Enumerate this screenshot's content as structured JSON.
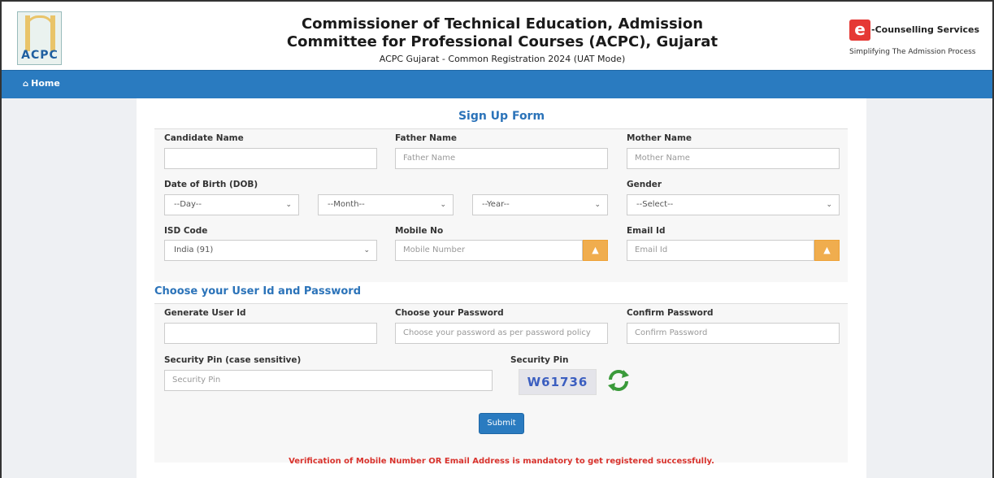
{
  "header": {
    "logo_text": "ACPC",
    "title_line1": "Commissioner of Technical Education, Admission",
    "title_line2": "Committee for Professional Courses (ACPC), Gujarat",
    "subtitle": "ACPC Gujarat - Common Registration 2024 (UAT Mode)",
    "ecoun_brand": "-Counselling Services",
    "ecoun_tagline": "Simplifying The Admission Process",
    "ecoun_mark": "e"
  },
  "nav": {
    "home_label": "Home"
  },
  "form": {
    "title": "Sign Up Form",
    "candidate_name": {
      "label": "Candidate Name",
      "value": "",
      "placeholder": ""
    },
    "father_name": {
      "label": "Father Name",
      "value": "",
      "placeholder": "Father Name"
    },
    "mother_name": {
      "label": "Mother Name",
      "value": "",
      "placeholder": "Mother Name"
    },
    "dob": {
      "label": "Date of Birth (DOB)",
      "day": "--Day--",
      "month": "--Month--",
      "year": "--Year--"
    },
    "gender": {
      "label": "Gender",
      "value": "--Select--"
    },
    "isd": {
      "label": "ISD Code",
      "value": "India (91)"
    },
    "mobile": {
      "label": "Mobile No",
      "placeholder": "Mobile Number"
    },
    "email": {
      "label": "Email Id",
      "placeholder": "Email Id"
    },
    "section2_title": "Choose your User Id and Password",
    "user_id": {
      "label": "Generate User Id",
      "value": ""
    },
    "password": {
      "label": "Choose your Password",
      "placeholder": "Choose your password as per password policy"
    },
    "confirm_password": {
      "label": "Confirm Password",
      "placeholder": "Confirm Password"
    },
    "security_pin_input": {
      "label": "Security Pin (case sensitive)",
      "placeholder": "Security Pin"
    },
    "security_pin": {
      "label": "Security Pin",
      "captcha": "W61736"
    },
    "submit_label": "Submit",
    "notice": "Verification of Mobile Number OR Email Address is mandatory to get registered successfully."
  },
  "colors": {
    "nav": "#2a7bc0",
    "title": "#2b73b9",
    "warning_button": "#f0ad4e",
    "notice": "#d9332d"
  }
}
